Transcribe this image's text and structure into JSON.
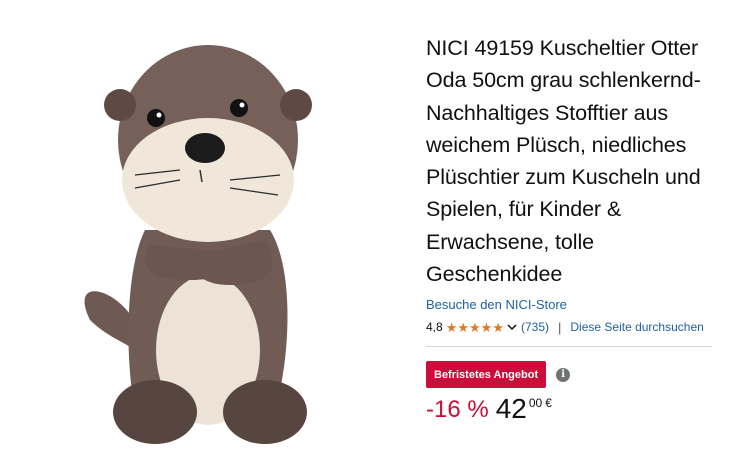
{
  "product": {
    "title": "NICI 49159 Kuscheltier Otter Oda 50cm grau schlenkernd-Nachhaltiges Stofftier aus weichem Plüsch, niedliches Plüschtier zum Kuscheln und Spielen, für Kinder & Erwachsene, tolle Geschenkidee",
    "image_icon": "plush-otter-image"
  },
  "store": {
    "link_text": "Besuche den NICI-Store"
  },
  "rating": {
    "value": "4,8",
    "stars": 5,
    "count": "(735)",
    "search_store_link": "Diese Seite durchsuchen"
  },
  "deal": {
    "badge": "Befristetes Angebot",
    "info_icon": "info-icon"
  },
  "price": {
    "discount": "-16 %",
    "whole": "42",
    "fraction": "00",
    "currency": "€"
  },
  "colors": {
    "link": "#2162a1",
    "star": "#de7921",
    "deal": "#cc0c39",
    "text": "#0f1111"
  }
}
